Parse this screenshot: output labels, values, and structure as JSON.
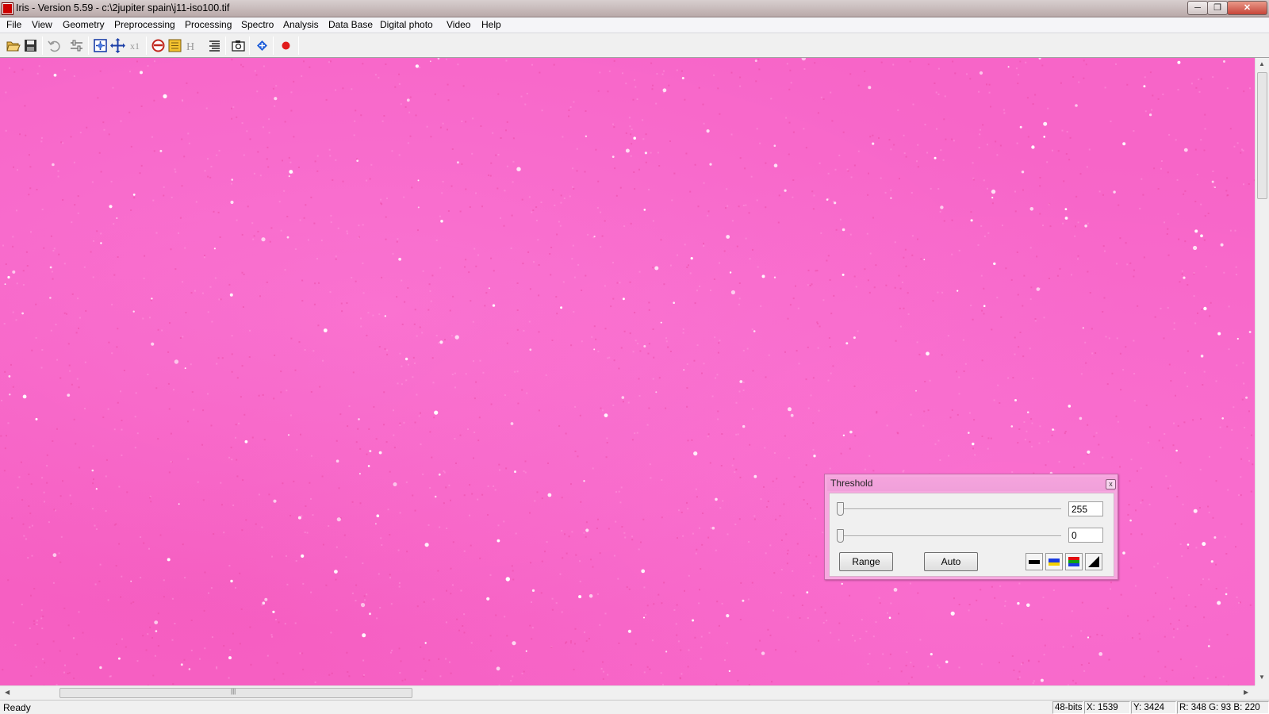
{
  "window": {
    "title": "Iris - Version 5.59 - c:\\2jupiter spain\\j11-iso100.tif",
    "minimize_glyph": "─",
    "maximize_glyph": "❐",
    "close_glyph": "✕"
  },
  "menu": {
    "items": [
      "File",
      "View",
      "Geometry",
      "Preprocessing",
      "Processing",
      "Spectro",
      "Analysis",
      "Data Base",
      "Digital photo",
      "Video",
      "Help"
    ]
  },
  "toolbar": {
    "icons": [
      "open-folder-icon",
      "save-disk-icon",
      "undo-icon",
      "settings-sliders-icon",
      "zoom-fit-icon",
      "move-cross-icon",
      "zoom-x1-icon",
      "red-cycle-icon",
      "yellow-box-icon",
      "histogram-h-icon",
      "list-lines-icon",
      "camera-icon",
      "blue-cross-icon",
      "red-dot-icon"
    ],
    "x1_label": "x1",
    "h_label": "H"
  },
  "scrollbars": {
    "up_glyph": "▲",
    "down_glyph": "▼",
    "left_glyph": "◀",
    "right_glyph": "▶",
    "grip_glyph": "|||"
  },
  "status": {
    "ready": "Ready",
    "bit_depth": "48-bits",
    "x": "X: 1539",
    "y": "Y: 3424",
    "rgb": "R: 348  G: 93  B: 220"
  },
  "threshold_dialog": {
    "title": "Threshold",
    "close_glyph": "x",
    "high_value": "255",
    "low_value": "0",
    "high_slider_fraction": 0.0,
    "low_slider_fraction": 0.0,
    "range_label": "Range",
    "auto_label": "Auto",
    "icons": [
      "black-bar-icon",
      "blue-yellow-bar-icon",
      "rgb-bars-icon",
      "gradient-ramp-icon"
    ]
  },
  "colors": {
    "image_background": "#f765c8",
    "dialog_frame": "#f7a8e0"
  }
}
